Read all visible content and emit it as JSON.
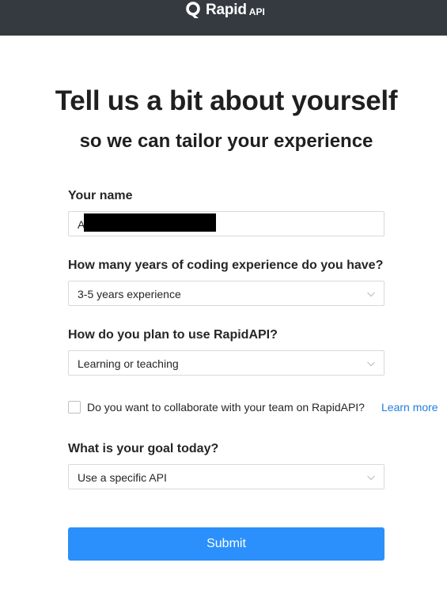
{
  "header": {
    "brand_name": "Rapid",
    "brand_suffix": "API"
  },
  "page": {
    "title": "Tell us a bit about yourself",
    "subtitle": "so we can tailor your experience"
  },
  "form": {
    "name": {
      "label": "Your name",
      "value": "A"
    },
    "experience": {
      "label": "How many years of coding experience do you have?",
      "value": "3-5 years experience"
    },
    "usage": {
      "label": "How do you plan to use RapidAPI?",
      "value": "Learning or teaching"
    },
    "collaborate": {
      "label": "Do you want to collaborate with your team on RapidAPI?",
      "link": "Learn more",
      "checked": false
    },
    "goal": {
      "label": "What is your goal today?",
      "value": "Use a specific API"
    },
    "submit_label": "Submit"
  },
  "colors": {
    "header_bg": "#343a40",
    "accent": "#2b90fb",
    "link": "#1f7fe0"
  },
  "icons": {
    "logo": "rapidapi-logo-icon",
    "select": "chevron-down-icon"
  }
}
